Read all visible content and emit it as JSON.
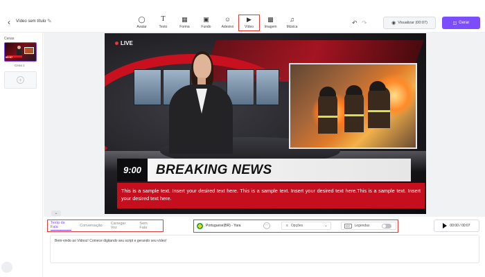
{
  "header": {
    "title": "Vídeo sem título",
    "tools": [
      {
        "label": "Avatar",
        "icon": "avatar-icon"
      },
      {
        "label": "Texto",
        "icon": "text-icon"
      },
      {
        "label": "Forma",
        "icon": "shape-icon"
      },
      {
        "label": "Fundo",
        "icon": "background-icon"
      },
      {
        "label": "Adesivo",
        "icon": "sticker-icon"
      },
      {
        "label": "Vídeo",
        "icon": "video-icon"
      },
      {
        "label": "Imagem",
        "icon": "image-icon"
      },
      {
        "label": "Música",
        "icon": "music-icon"
      }
    ],
    "active_tool": "Vídeo",
    "preview_label": "Visualizar (00:07)",
    "generate_label": "Gerar"
  },
  "scenes": {
    "label": "Cenas",
    "items": [
      {
        "caption": "Cena 1",
        "time": "00:07"
      }
    ]
  },
  "canvas": {
    "live_label": "LIVE",
    "clock": "9:00",
    "headline": "BREAKING NEWS",
    "ticker": "This is a sample text. Insert your desired text here. This is a sample text. Insert your desired text here.This is a sample text. Insert your desired text here."
  },
  "bottom": {
    "tabs": [
      "Texto de Fala",
      "Conversação",
      "Carregar Voz",
      "Sem Fala"
    ],
    "active_tab": "Texto de Fala",
    "voice": "Portuguese(BR) - Yara",
    "options_label": "Opções",
    "captions_label": "Legendas",
    "captions_enabled": false,
    "playback": "00:00 / 00:07",
    "script_text": "Bem-vindo ao Vidnoz! Comece digitando seu script e gerando seu vídeo!"
  },
  "colors": {
    "accent": "#7c4dff",
    "highlight": "#e53935",
    "news_red": "#c50f1f"
  }
}
